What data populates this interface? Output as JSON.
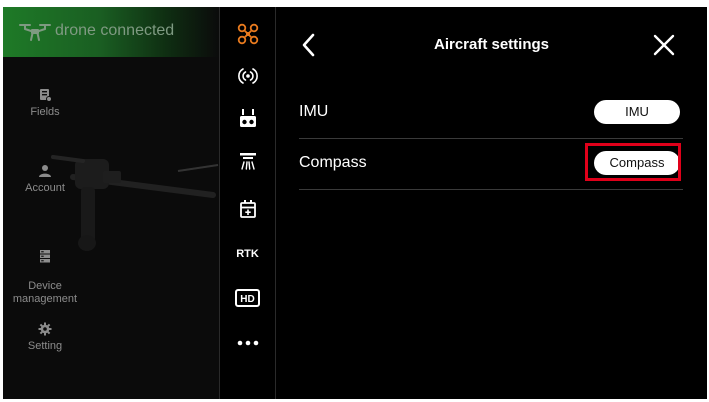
{
  "sidebar": {
    "connection_status": "drone connected",
    "items": [
      {
        "label": "Fields",
        "icon": "fields-icon"
      },
      {
        "label": "Account",
        "icon": "account-icon"
      },
      {
        "label": "Device\nmanagement",
        "icon": "device-management-icon"
      },
      {
        "label": "Setting",
        "icon": "gear-icon"
      }
    ]
  },
  "icon_strip": {
    "items": [
      {
        "name": "aircraft-icon",
        "active": true
      },
      {
        "name": "radar-icon"
      },
      {
        "name": "remote-controller-icon"
      },
      {
        "name": "spray-icon"
      },
      {
        "name": "battery-icon"
      },
      {
        "name": "rtk",
        "text": "RTK"
      },
      {
        "name": "hd-video",
        "text": "HD"
      },
      {
        "name": "more-icon"
      }
    ]
  },
  "panel": {
    "title": "Aircraft settings",
    "rows": [
      {
        "label": "IMU",
        "button": "IMU"
      },
      {
        "label": "Compass",
        "button": "Compass"
      }
    ]
  },
  "colors": {
    "accent_orange": "#e87a1e",
    "highlight_red": "#e0001a",
    "connected_green": "#1e7a27"
  }
}
